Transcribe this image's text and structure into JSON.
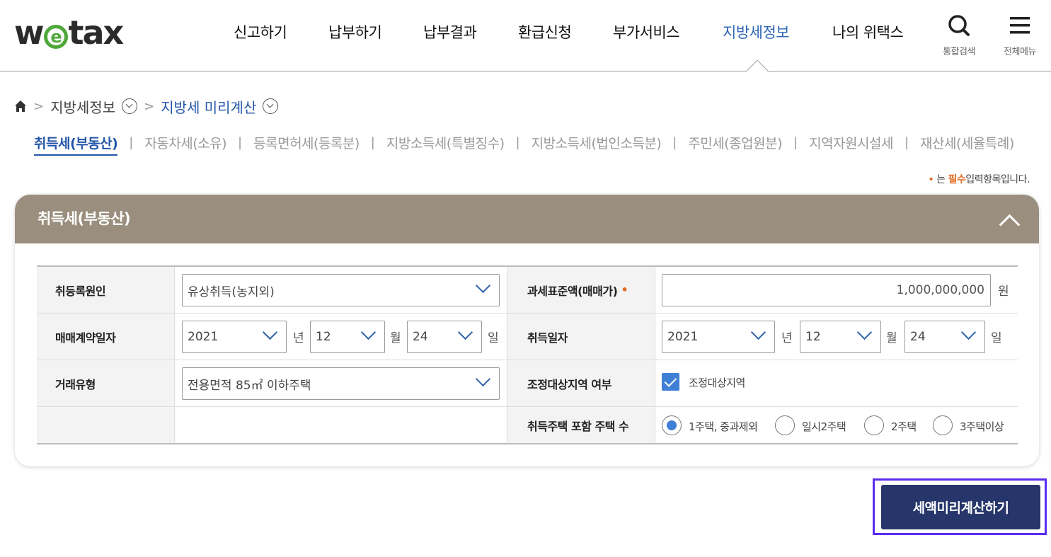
{
  "header": {
    "logo": {
      "pre": "w",
      "mid": "e",
      "post": "tax"
    },
    "nav": [
      {
        "label": "신고하기"
      },
      {
        "label": "납부하기"
      },
      {
        "label": "납부결과"
      },
      {
        "label": "환급신청"
      },
      {
        "label": "부가서비스"
      },
      {
        "label": "지방세정보"
      },
      {
        "label": "나의 위택스"
      }
    ],
    "active_nav": "지방세정보",
    "search_label": "통합검색",
    "menu_label": "전체메뉴"
  },
  "breadcrumb": {
    "level1": "지방세정보",
    "level2": "지방세 미리계산"
  },
  "tabs": [
    {
      "label": "취득세(부동산)"
    },
    {
      "label": "자동차세(소유)"
    },
    {
      "label": "등록면허세(등록분)"
    },
    {
      "label": "지방소득세(특별징수)"
    },
    {
      "label": "지방소득세(법인소득분)"
    },
    {
      "label": "주민세(종업원분)"
    },
    {
      "label": "지역자원시설세"
    },
    {
      "label": "재산세(세율특례)"
    }
  ],
  "required_note": {
    "dot": "•",
    "pre": "는",
    "must": "필수",
    "post": "입력항목입니다."
  },
  "panel": {
    "title": "취득세(부동산)",
    "fields": {
      "cause_label": "취등록원인",
      "cause_value": "유상취득(농지외)",
      "base_label": "과세표준액(매매가)",
      "base_required": "•",
      "base_value": "1,000,000,000",
      "base_unit": "원",
      "contract_label": "매매계약일자",
      "contract_year": "2021",
      "contract_month": "12",
      "contract_day": "24",
      "acq_label": "취득일자",
      "acq_year": "2021",
      "acq_month": "12",
      "acq_day": "24",
      "unit_year": "년",
      "unit_month": "월",
      "unit_day": "일",
      "type_label": "거래유형",
      "type_value": "전용면적 85㎡ 이하주택",
      "adjust_label": "조정대상지역 여부",
      "adjust_check_label": "조정대상지역",
      "adjust_checked": true,
      "count_label": "취득주택 포함 주택 수",
      "count_options": [
        "1주택, 중과제외",
        "일시2주택",
        "2주택",
        "3주택이상"
      ],
      "count_selected": "1주택, 중과제외"
    }
  },
  "calc_button": "세액미리계산하기",
  "colors": {
    "accent": "#2f67b5",
    "panel_head": "#9a8f7e",
    "button": "#26366a",
    "required": "#e06a20",
    "highlight": "#5b2cf0"
  }
}
